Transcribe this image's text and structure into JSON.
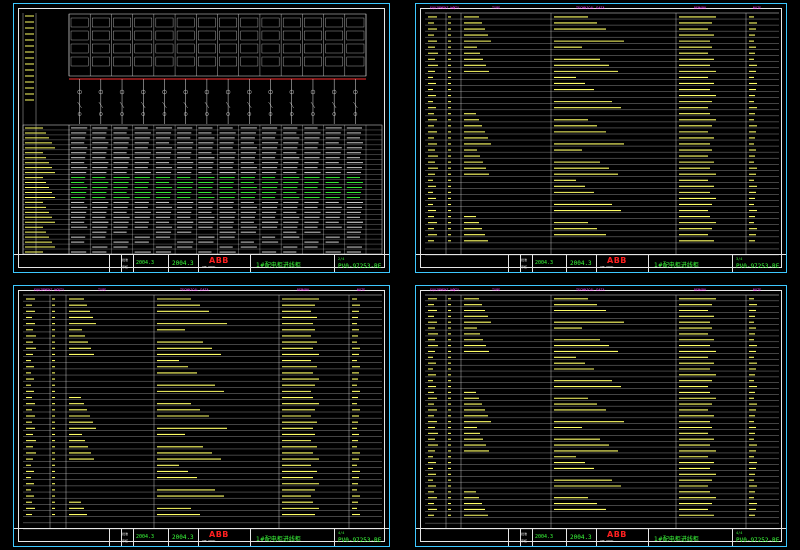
{
  "colors": {
    "sheet_border": "#3dc8ff",
    "frame": "#e6e6e6",
    "header_text": "#ff40ff",
    "title_text": "#3bff3b",
    "logo": "#ff2020",
    "table_text": "#ffff66",
    "data_text": "#3bff3b"
  },
  "sheets": [
    {
      "titleblock": {
        "logo": "ABB",
        "logo_sub": "ABB CHINA",
        "date": "2004.3",
        "project": "1#配电柜进线柜",
        "drawing_no": "PV0-97253-RE",
        "sheet_no": "2/4",
        "approved_label": "批准",
        "checked_label": "审核"
      }
    },
    {
      "headers": [
        "EQUIPMENT NO",
        "QTY",
        "TYPE",
        "TECHNICAL DATA",
        "REMARK",
        "NOTE"
      ],
      "titleblock": {
        "logo": "ABB",
        "logo_sub": "ABB CHINA",
        "date": "2004.3",
        "project": "1#配电柜进线柜",
        "drawing_no": "PV0-97253-RE",
        "sheet_no": "3/4",
        "approved_label": "批准",
        "checked_label": "审核"
      }
    },
    {
      "headers": [
        "EQUIPMENT NO",
        "QTY",
        "TYPE",
        "TECHNICAL DATA",
        "REMARK",
        "NOTE"
      ],
      "titleblock": {
        "logo": "ABB",
        "logo_sub": "ABB CHINA",
        "date": "2004.3",
        "project": "1#配电柜进线柜",
        "drawing_no": "PV0-97253-RE",
        "sheet_no": "4/4",
        "approved_label": "批准",
        "checked_label": "审核"
      }
    },
    {
      "headers": [
        "EQUIPMENT NO",
        "QTY",
        "TYPE",
        "TECHNICAL DATA",
        "REMARK",
        "NOTE"
      ],
      "titleblock": {
        "logo": "ABB",
        "logo_sub": "ABB CHINA",
        "date": "2004.3",
        "project": "1#配电柜进线柜",
        "drawing_no": "PV0-97252-RE",
        "sheet_no": "4/4",
        "approved_label": "批准",
        "checked_label": "审核"
      }
    }
  ]
}
